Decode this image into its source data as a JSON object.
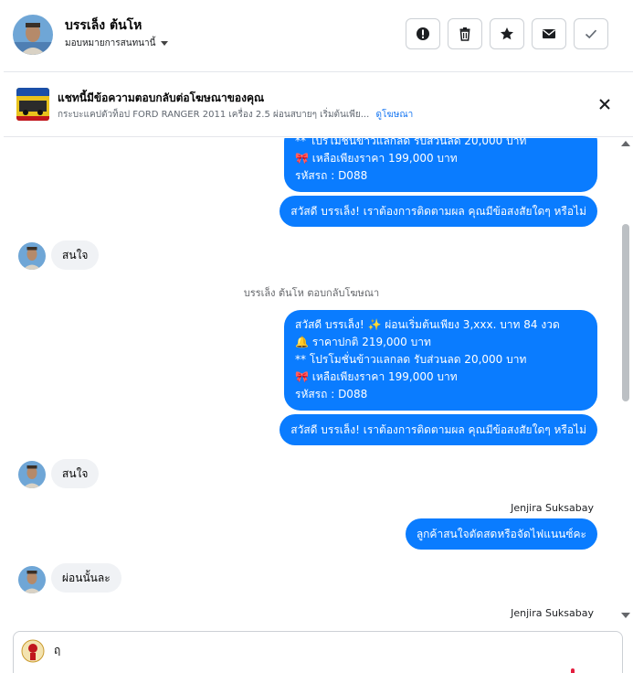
{
  "header": {
    "contact_name": "บรรเล็ง ต้นโห",
    "assignee_label": "มอบหมายการสนทนานี้",
    "actions": [
      {
        "icon": "alert-icon",
        "name": "mark-spam-button"
      },
      {
        "icon": "trash-icon",
        "name": "delete-button"
      },
      {
        "icon": "star-icon",
        "name": "star-button"
      },
      {
        "icon": "envelope-icon",
        "name": "mark-unread-button"
      },
      {
        "icon": "check-icon",
        "name": "mark-done-button"
      }
    ]
  },
  "banner": {
    "title": "แชทนี้มีข้อความตอบกลับต่อโฆษณาของคุณ",
    "subtitle": "กระบะแคปตัวท็อป FORD RANGER 2011 เครื่อง 2.5 ผ่อนสบายๆ เริ่มต้นเพีย...",
    "link": "ดูโฆษณา"
  },
  "messages": {
    "m1_lines": [
      "** โปรโมชั่นข้าวแลกลด รับส่วนลด 20,000 บาท",
      "🎀  เหลือเพียงราคา 199,000 บาท",
      "รหัสรถ : D088"
    ],
    "m2": "สวัสดี บรรเล็ง! เราต้องการติดตามผล คุณมีข้อสงสัยใดๆ หรือไม่",
    "m3": "สนใจ",
    "sys_note": "บรรเล็ง ต้นโห ตอบกลับโฆษณา",
    "m4_lines": [
      "สวัสดี บรรเล็ง! ✨  ผ่อนเริ่มต้นเพียง 3,xxx. บาท 84 งวด",
      "🔔 ราคาปกติ 219,000 บาท",
      "** โปรโมชั่นข้าวแลกลด รับส่วนลด 20,000 บาท",
      "🎀  เหลือเพียงราคา 199,000 บาท",
      " รหัสรถ : D088"
    ],
    "m5": "สวัสดี บรรเล็ง! เราต้องการติดตามผล คุณมีข้อสงสัยใดๆ หรือไม่",
    "m6": "สนใจ",
    "sender1": "Jenjira Suksabay",
    "m7": "ลูกค้าสนใจตัดสดหรือจัดไฟแนนซ์คะ",
    "m8": "ผ่อนนั้นละ",
    "sender2": "Jenjira Suksabay"
  },
  "composer": {
    "value": "ฤ"
  },
  "colors": {
    "outgoing_bubble": "#0a7cff",
    "incoming_bubble": "#f0f2f5",
    "link": "#1877f2"
  }
}
